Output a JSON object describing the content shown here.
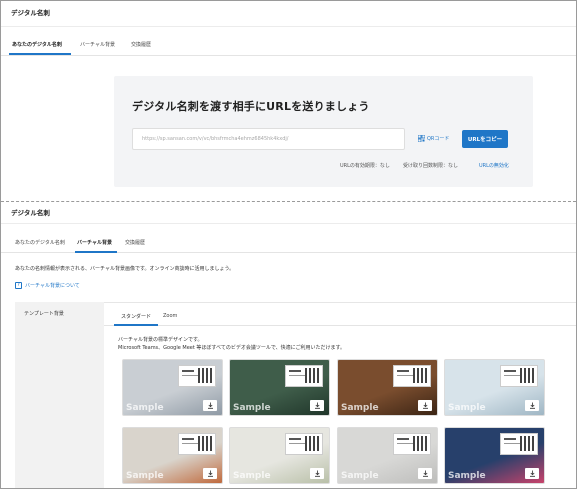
{
  "top": {
    "heading": "デジタル名刺",
    "tabs": [
      "あなたのデジタル名刺",
      "バーチャル背景",
      "交換履歴"
    ],
    "panel": {
      "title": "デジタル名刺を渡す相手にURLを送りましょう",
      "url": "https://sp.sansan.com/v/vc/bhsfrmcha4ehmz6845hk4kxdj/",
      "qr_label": "QRコード",
      "copy_label": "URLをコピー",
      "expiry": "URLの有効期限：なし",
      "limit": "受け取り回数制限：なし",
      "disable_link": "URLの無効化"
    }
  },
  "bottom": {
    "heading": "デジタル名刺",
    "tabs": [
      "あなたのデジタル名刺",
      "バーチャル背景",
      "交換履歴"
    ],
    "description": "あなたの名刺情報が表示される、バーチャル背景画像です。オンライン商談時に活用しましょう。",
    "help_link": "バーチャル背景について",
    "sidebar_label": "テンプレート背景",
    "sub_tabs": [
      "スタンダード",
      "Zoom"
    ],
    "sub_desc_1": "バーチャル背景の標準デザインです。",
    "sub_desc_2": "Microsoft Teams、Google Meet 等ほぼすべてのビデオ会議ツールで、快適にご利用いただけます。",
    "thumbnails": [
      {
        "bg": "#c9ced3",
        "accent": "#8f9aa5",
        "sample": "Sample"
      },
      {
        "bg": "#3f5d4a",
        "accent": "#20362a",
        "sample": "Sample"
      },
      {
        "bg": "#7a4d2e",
        "accent": "#3b2414",
        "sample": "Sample"
      },
      {
        "bg": "#d7e3ea",
        "accent": "#9fb6c4",
        "sample": "Sample"
      },
      {
        "bg": "#d9d4cc",
        "accent": "#c06a3d",
        "sample": "Sample"
      },
      {
        "bg": "#e6e6e0",
        "accent": "#b9c0a8",
        "sample": "Sample"
      },
      {
        "bg": "#d8d8d6",
        "accent": "#bdbdbb",
        "sample": "Sample"
      },
      {
        "bg": "#27406b",
        "accent": "#c8436b",
        "sample": "Sample"
      }
    ]
  }
}
